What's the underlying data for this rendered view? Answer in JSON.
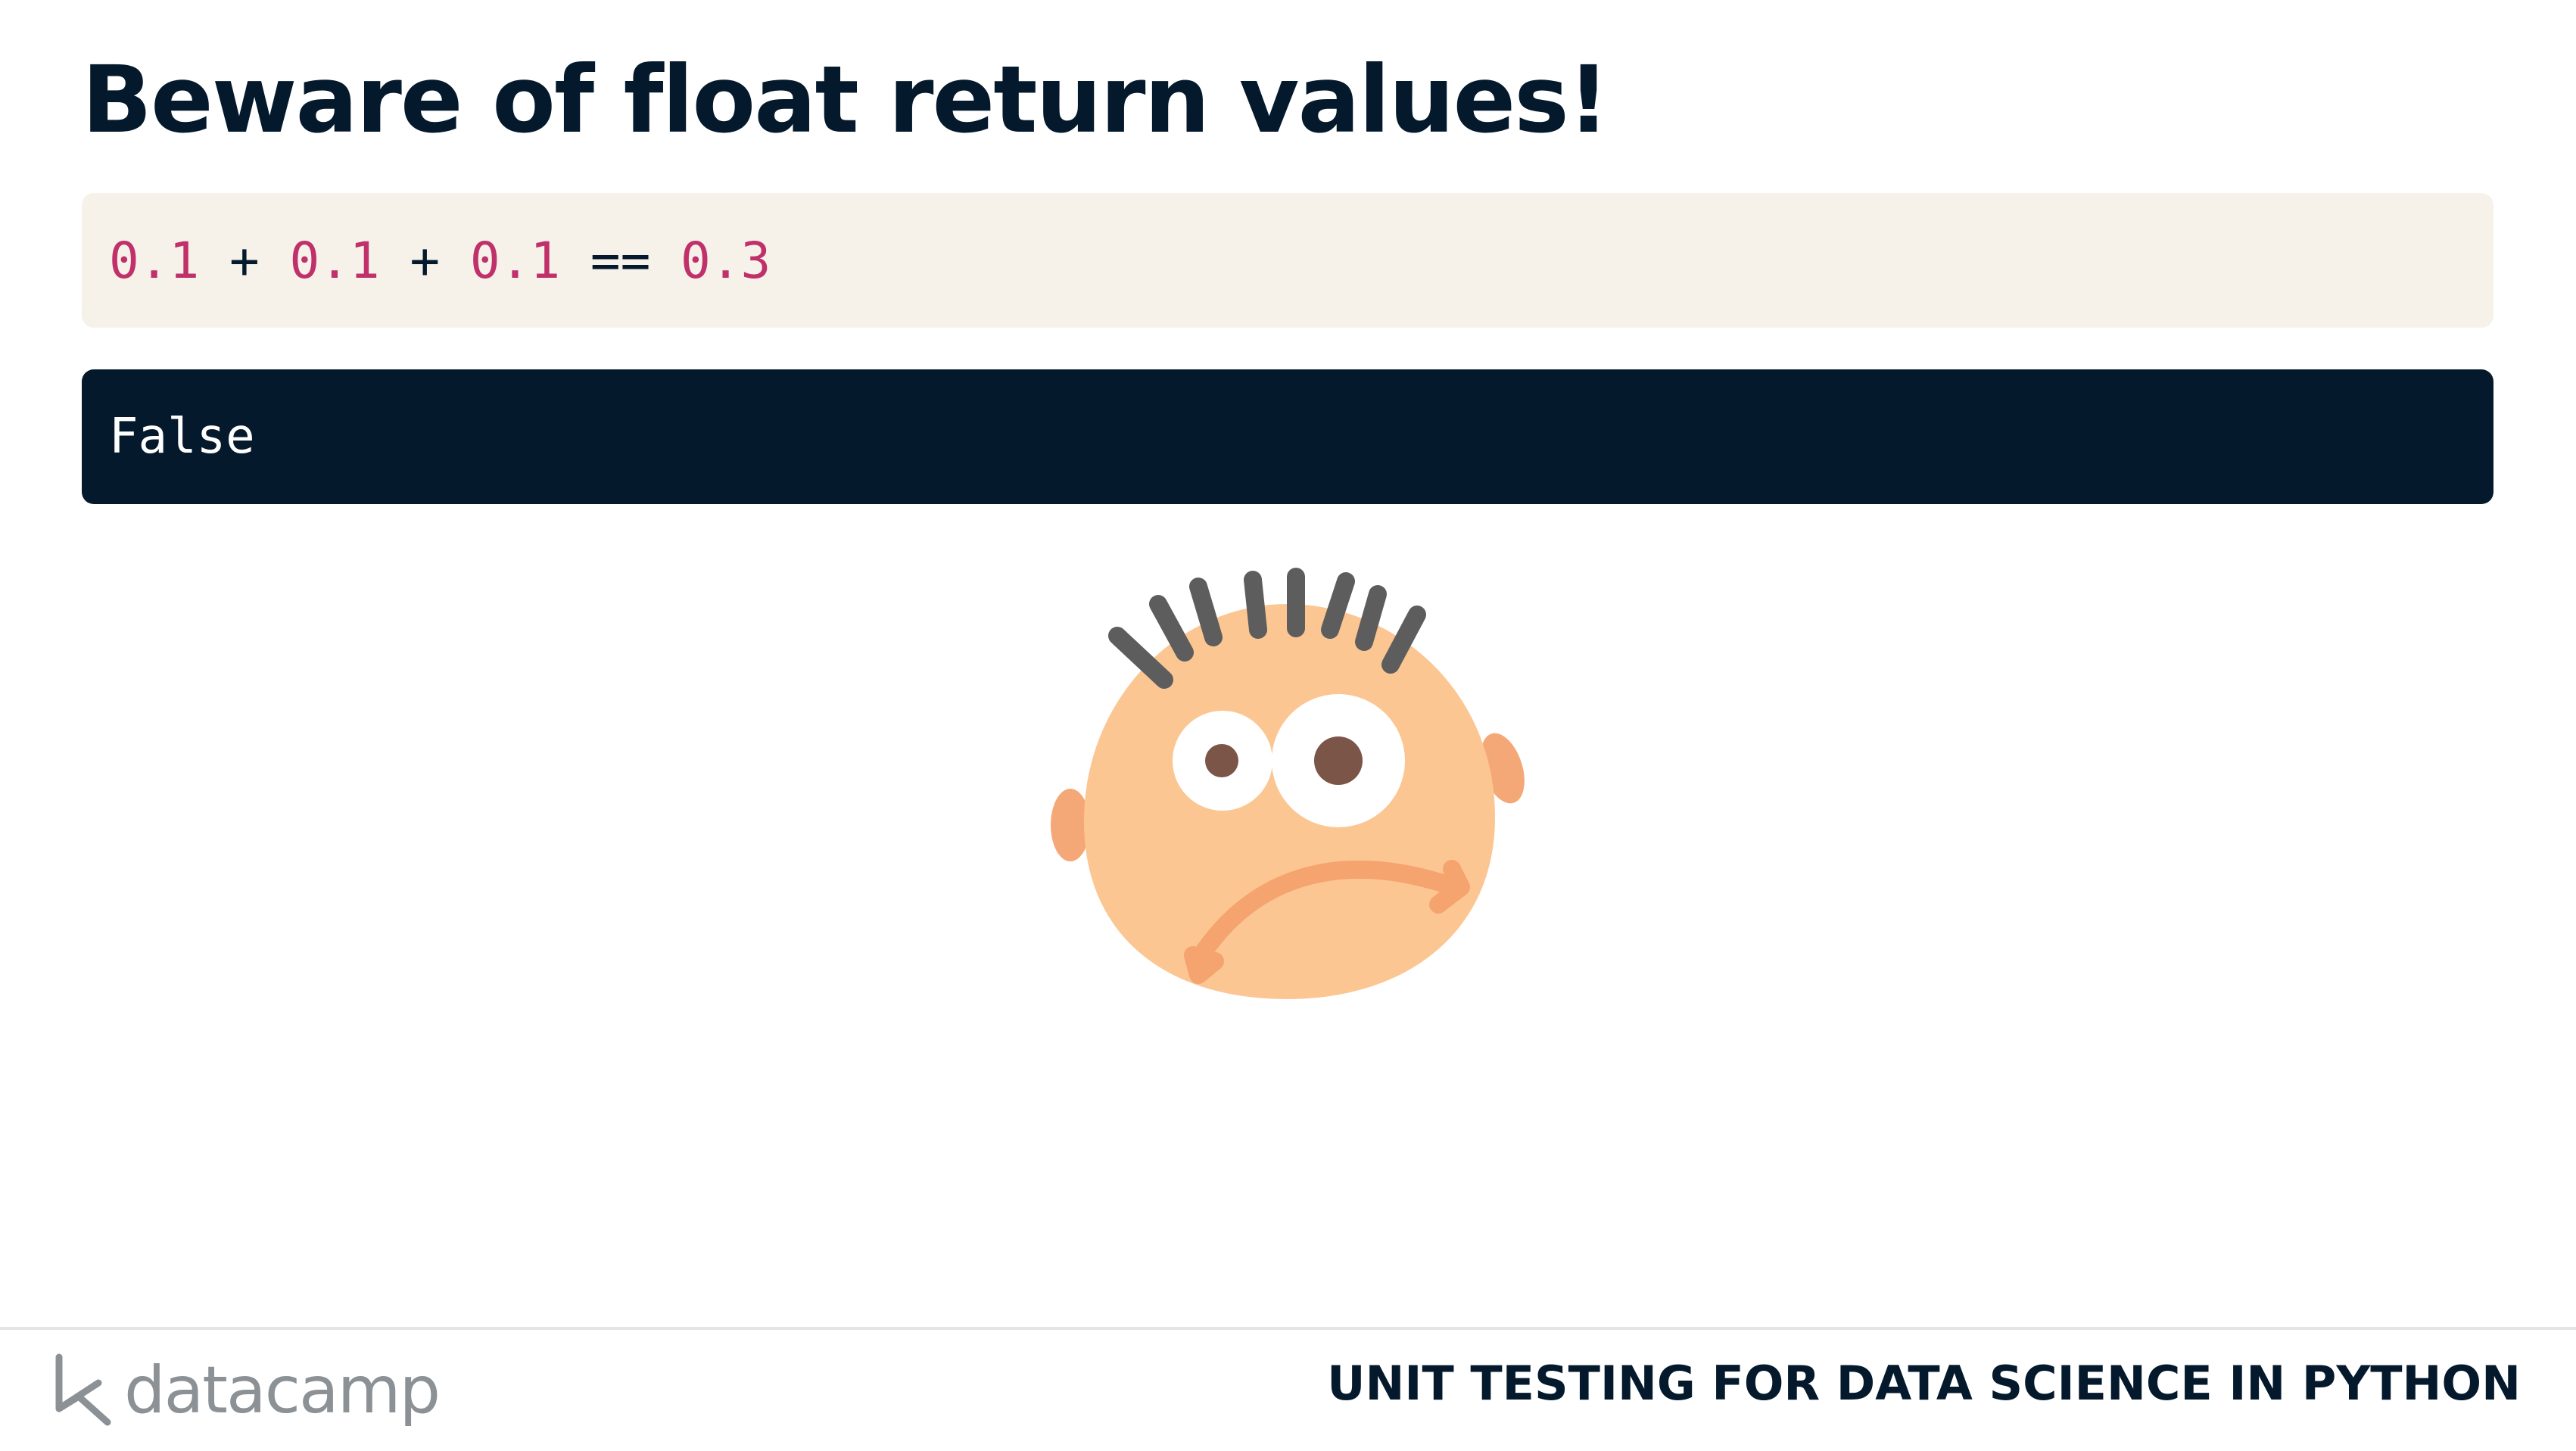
{
  "slide": {
    "title": "Beware of float return values!"
  },
  "code": {
    "tokens": [
      {
        "text": "0.1",
        "kind": "number"
      },
      {
        "text": " + ",
        "kind": "operator"
      },
      {
        "text": "0.1",
        "kind": "number"
      },
      {
        "text": " + ",
        "kind": "operator"
      },
      {
        "text": "0.1",
        "kind": "number"
      },
      {
        "text": " == ",
        "kind": "operator"
      },
      {
        "text": "0.3",
        "kind": "number"
      }
    ],
    "background_color": "#f6f2ea",
    "number_color": "#c0306a"
  },
  "output": {
    "text": "False",
    "background_color": "#05192d"
  },
  "illustration": {
    "icon": "confused-face-icon"
  },
  "footer": {
    "logo_text": "datacamp",
    "logo_icon": "datacamp-logo-icon",
    "course_title": "UNIT TESTING FOR DATA SCIENCE IN PYTHON"
  },
  "colors": {
    "title": "#05192d",
    "logo_gray": "#8c9196"
  }
}
